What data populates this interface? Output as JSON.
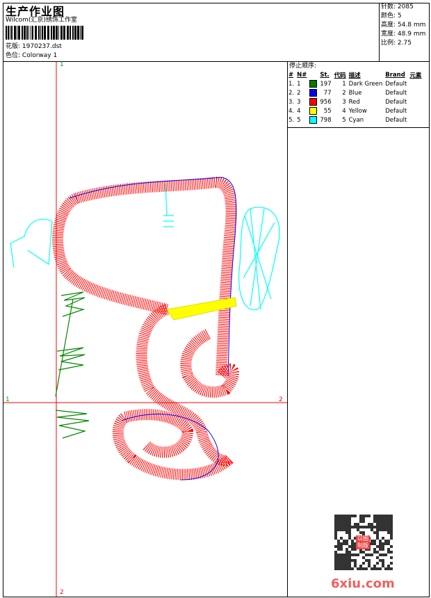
{
  "header": {
    "title": "生产作业图",
    "company": "Wilcom(汇京)绣饰工作室",
    "design_label": "花版:",
    "design_value": "1970237.dst",
    "colorway_label": "色位:",
    "colorway_value": "Colorway 1"
  },
  "stats": [
    {
      "label": "针数:",
      "value": "2085"
    },
    {
      "label": "颜色:",
      "value": "5"
    },
    {
      "label": "高度:",
      "value": "54.8 mm"
    },
    {
      "label": "宽度:",
      "value": "48.9 mm"
    },
    {
      "label": "比例:",
      "value": "2.75"
    }
  ],
  "stop_sequence": {
    "title": "停止顺序:",
    "headers": [
      "#",
      "N#",
      "St.",
      "代码",
      "描述",
      "Brand",
      "元素"
    ],
    "rows": [
      {
        "idx": "1.",
        "n": "1",
        "color": "#008000",
        "st": "197",
        "code": "1",
        "desc": "Dark Green",
        "brand": "Default"
      },
      {
        "idx": "2.",
        "n": "2",
        "color": "#0000ff",
        "st": "77",
        "code": "2",
        "desc": "Blue",
        "brand": "Default"
      },
      {
        "idx": "3.",
        "n": "3",
        "color": "#ff0000",
        "st": "956",
        "code": "3",
        "desc": "Red",
        "brand": "Default"
      },
      {
        "idx": "4.",
        "n": "4",
        "color": "#ffff00",
        "st": "55",
        "code": "4",
        "desc": "Yellow",
        "brand": "Default"
      },
      {
        "idx": "5.",
        "n": "5",
        "color": "#00ffff",
        "st": "798",
        "code": "5",
        "desc": "Cyan",
        "brand": "Default"
      }
    ]
  },
  "axes": {
    "v_top": "1",
    "v_bottom": "2",
    "h_left": "1",
    "h_right": "2"
  },
  "watermark": {
    "text": "6xiu.com",
    "seal": "以图制版"
  }
}
